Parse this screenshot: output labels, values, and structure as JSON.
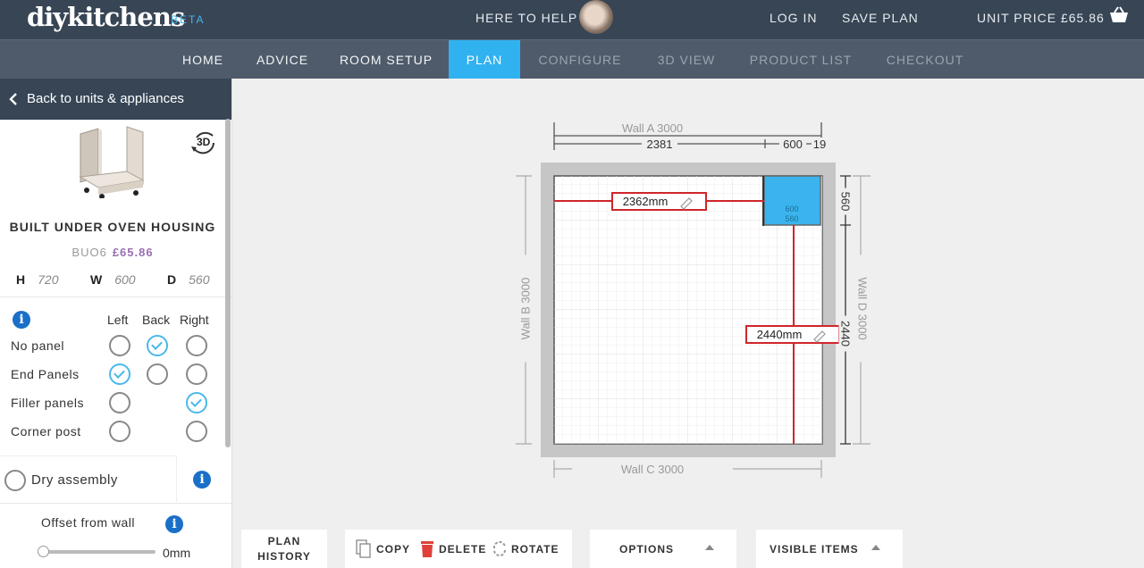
{
  "header": {
    "logo_text": "diykitchens",
    "logo_beta": "BETA",
    "help": "HERE TO HELP",
    "login": "LOG IN",
    "save_plan": "SAVE PLAN",
    "unit_price": "UNIT PRICE £65.86"
  },
  "nav": [
    "HOME",
    "ADVICE",
    "ROOM SETUP",
    "PLAN",
    "CONFIGURE",
    "3D VIEW",
    "PRODUCT LIST",
    "CHECKOUT"
  ],
  "nav_active": "PLAN",
  "panel": {
    "back": "Back to units & appliances",
    "badge_3d": "3D",
    "unit_name": "BUILT UNDER OVEN HOUSING",
    "code": "BUO6",
    "price": "£65.86",
    "dims": {
      "h_label": "H",
      "h": "720",
      "w_label": "W",
      "w": "600",
      "d_label": "D",
      "d": "560"
    },
    "info": "i",
    "columns": [
      "Left",
      "Back",
      "Right"
    ],
    "rows": [
      {
        "label": "No panel",
        "left": "off",
        "back": "on",
        "right": "off"
      },
      {
        "label": "End Panels",
        "left": "on",
        "back": "off",
        "right": "off"
      },
      {
        "label": "Filler panels",
        "left": "off",
        "back": "none",
        "right": "on"
      },
      {
        "label": "Corner post",
        "left": "off",
        "back": "none",
        "right": "off"
      }
    ],
    "dry_assembly": "Dry assembly",
    "offset_label": "Offset from wall",
    "offset_value": "0mm"
  },
  "plan": {
    "wall_a": "Wall A  3000",
    "wall_b": "Wall B  3000",
    "wall_c": "Wall C  3000",
    "wall_d": "Wall D  3000",
    "dim_top_1": "2381",
    "dim_top_2": "600",
    "dim_top_3": "19",
    "dim_right_1": "560",
    "dim_right_2": "2440",
    "measure_1": "2362mm",
    "measure_2": "2440mm",
    "unit_label_1": "600",
    "unit_label_2": "560"
  },
  "toolbar": {
    "plan_history_1": "PLAN",
    "plan_history_2": "HISTORY",
    "copy": "COPY",
    "delete": "DELETE",
    "rotate": "ROTATE",
    "options": "OPTIONS",
    "visible_items": "VISIBLE ITEMS"
  },
  "colors": {
    "header_bg": "#374555",
    "nav_bg": "#4f5b6b",
    "active_tab": "#31b2f0",
    "price": "#9a6fb3",
    "check": "#4ab8ea",
    "measure_line": "#d0262c",
    "selected_unit": "#3bb4ee",
    "delete_icon": "#e0403a"
  }
}
